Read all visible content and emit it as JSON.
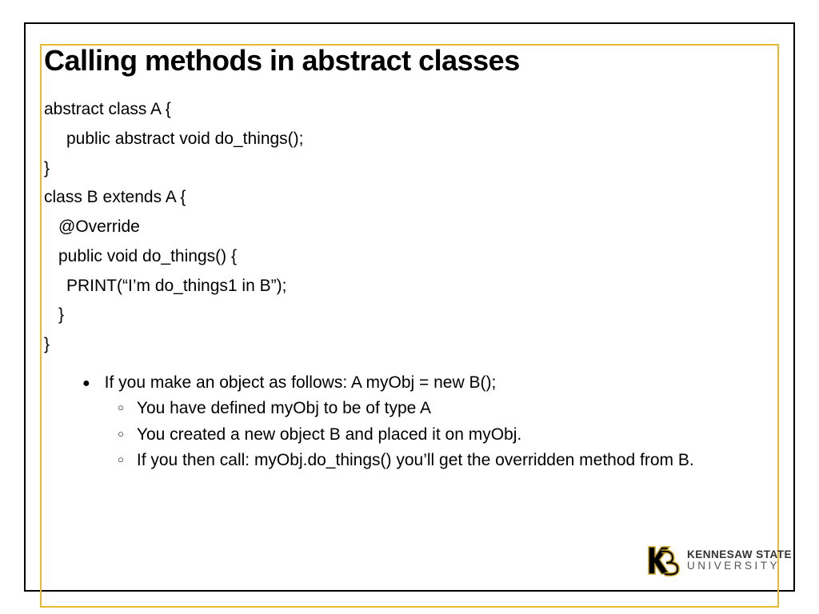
{
  "title": "Calling methods in abstract classes",
  "code": {
    "l1": "abstract class A {",
    "l2": "public abstract void do_things();",
    "l3": "}",
    "l4": "class B extends A {",
    "l5": "@Override",
    "l6": "public void do_things() {",
    "l7": "PRINT(“I’m do_things1 in B”);",
    "l8": "}",
    "l9": "}"
  },
  "bullets": {
    "main": "If you make an object as follows:  A myObj = new B();",
    "sub1": "You have defined myObj to be of type A",
    "sub2": "You created a new object B and placed it on myObj.",
    "sub3": "If you then call:  myObj.do_things() you’ll get the overridden method from B."
  },
  "logo": {
    "name_top": "KENNESAW STATE",
    "name_bottom": "UNIVERSITY"
  }
}
